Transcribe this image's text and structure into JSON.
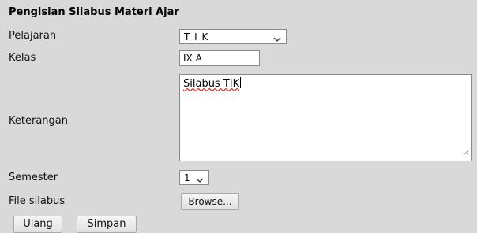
{
  "form": {
    "title": "Pengisian Silabus Materi Ajar",
    "pelajaran": {
      "label": "Pelajaran",
      "value": "T I K"
    },
    "kelas": {
      "label": "Kelas",
      "value": "IX A"
    },
    "keterangan": {
      "label": "Keterangan",
      "value": "Silabus TIK"
    },
    "semester": {
      "label": "Semester",
      "value": "1"
    },
    "file": {
      "label": "File silabus",
      "browse_label": "Browse..."
    }
  },
  "buttons": {
    "reset_label": "Ulang",
    "save_label": "Simpan"
  },
  "icons": {
    "dropdown": "chevron-down-icon",
    "resize": "resize-grip-icon"
  },
  "colors": {
    "background": "#d9d9d9",
    "field": "#ffffff",
    "border": "#8a8a8a",
    "spellcheck": "#d33333"
  }
}
